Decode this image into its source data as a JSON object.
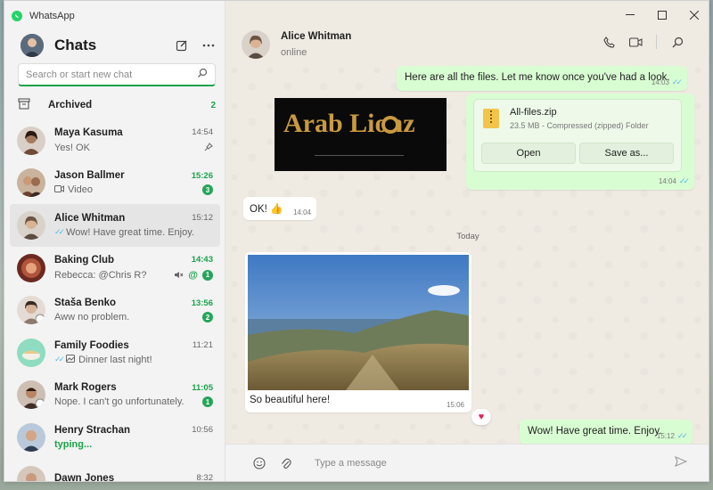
{
  "app": {
    "title": "WhatsApp"
  },
  "sidebar": {
    "title": "Chats",
    "search_placeholder": "Search or start new chat",
    "archived": {
      "label": "Archived",
      "count": "2"
    },
    "chats": [
      {
        "name": "Maya Kasuma",
        "time": "14:54",
        "preview": "Yes! OK",
        "pinned": true,
        "avatar_color": "#8a6b5a"
      },
      {
        "name": "Jason Ballmer",
        "time": "15:26",
        "preview": "Video",
        "badge": "3",
        "unread": true,
        "avatar_color": "#7b5b4a"
      },
      {
        "name": "Alice Whitman",
        "time": "15:12",
        "preview": "Wow! Have great time. Enjoy.",
        "ticks": true,
        "active": true,
        "avatar_color": "#9a8b7c"
      },
      {
        "name": "Baking Club",
        "time": "14:43",
        "preview": "Rebecca: @Chris R?",
        "badge": "1",
        "mention": "@",
        "muted": true,
        "unread": true,
        "avatar_color": "#8b3a2f"
      },
      {
        "name": "Staša Benko",
        "time": "13:56",
        "preview": "Aww no problem.",
        "badge": "2",
        "unread": true,
        "avatar_color": "#b6a499"
      },
      {
        "name": "Family Foodies",
        "time": "11:21",
        "preview": "Dinner last night!",
        "ticks": true,
        "avatar_color": "#6cc9a8"
      },
      {
        "name": "Mark Rogers",
        "time": "11:05",
        "preview": "Nope. I can't go unfortunately.",
        "badge": "1",
        "unread": true,
        "avatar_color": "#7a5746"
      },
      {
        "name": "Henry Strachan",
        "time": "10:56",
        "preview": "typing...",
        "typing": true,
        "avatar_color": "#5a6f8a"
      },
      {
        "name": "Dawn Jones",
        "time": "8:32",
        "preview": "",
        "avatar_color": "#9b7b6b"
      }
    ]
  },
  "conversation": {
    "name": "Alice Whitman",
    "status": "online",
    "messages": {
      "m1_text": "Here are all the files. Let me know once you've had a look.",
      "m1_time": "14:03",
      "logo_text": "Arab Lionz",
      "file_name": "All-files.zip",
      "file_meta": "23.5 MB - Compressed (zipped) Folder",
      "open_label": "Open",
      "saveas_label": "Save as...",
      "file_time": "14:04",
      "m2_text": "OK! 👍",
      "m2_time": "14:04",
      "day_label": "Today",
      "photo_caption": "So beautiful here!",
      "photo_time": "15:06",
      "reaction": "♥",
      "m3_text": "Wow! Have great time. Enjoy.",
      "m3_time": "15:12"
    },
    "composer_placeholder": "Type a message"
  },
  "colors": {
    "accent": "#25d366",
    "outgoing": "#d9fdd3",
    "badge": "#25a55a",
    "ticks": "#53bdeb"
  }
}
